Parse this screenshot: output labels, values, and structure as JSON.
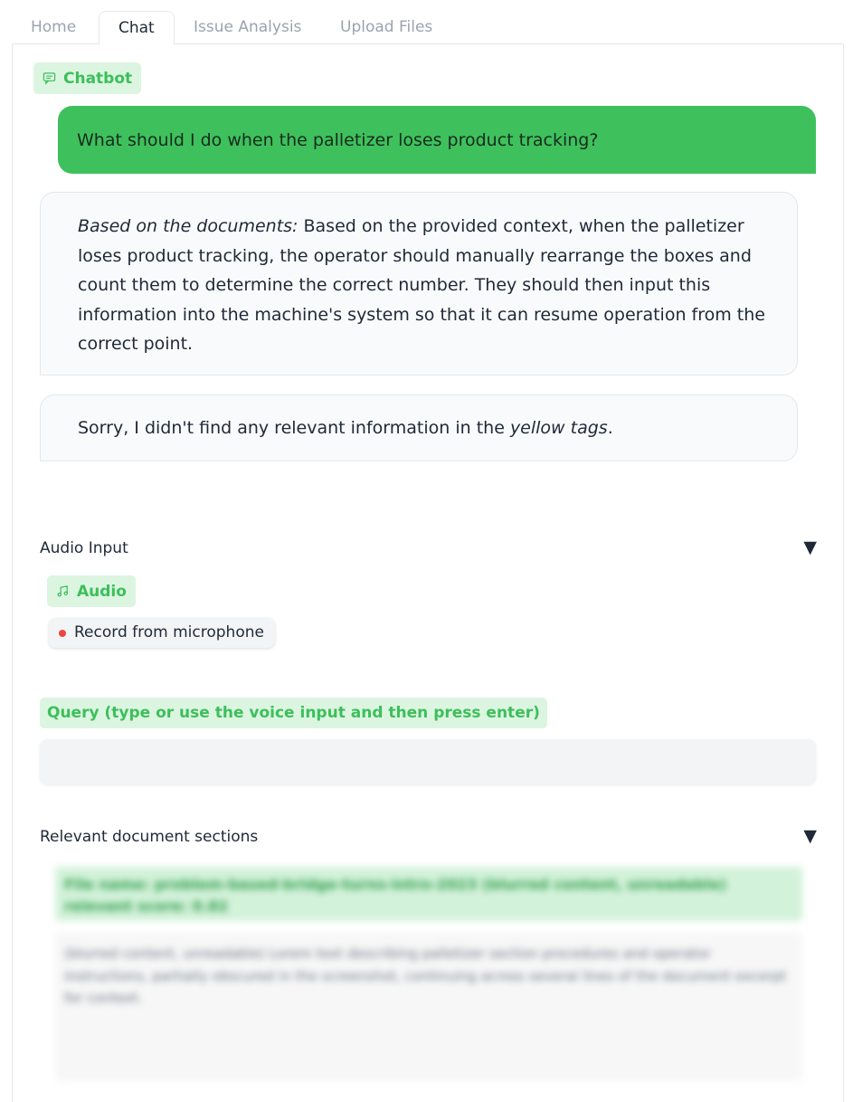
{
  "tabs": [
    "Home",
    "Chat",
    "Issue Analysis",
    "Upload Files"
  ],
  "chatbot": {
    "label": "Chatbot",
    "user_message": "What should I do when the palletizer loses product tracking?",
    "bot_message_1_prefix": "Based on the documents:",
    "bot_message_1_body": " Based on the provided context, when the palletizer loses product tracking, the operator should manually rearrange the boxes and count them to determine the correct number. They should then input this information into the machine's system so that it can resume operation from the correct point.",
    "bot_message_2_before": "Sorry, I didn't find any relevant information in the ",
    "bot_message_2_em": "yellow tags",
    "bot_message_2_after": "."
  },
  "audio": {
    "section_title": "Audio Input",
    "label": "Audio",
    "record_button": "Record from microphone"
  },
  "query": {
    "label": "Query (type or use the voice input and then press enter)",
    "value": ""
  },
  "docs": {
    "section_title": "Relevant document sections",
    "toggle_icon": "▼",
    "blurred_header": "File name: problem-based-bridge-turns-intro-2023 (blurred content, unreadable) relevant score: 0.82",
    "blurred_body": "(blurred content, unreadable) Lorem text describing palletizer section procedures and operator instructions, partially obscured in the screenshot, continuing across several lines of the document excerpt for context."
  },
  "colors": {
    "accent": "#3ec15c",
    "accent_light": "#dcf5e1",
    "record_dot": "#ef4444"
  }
}
